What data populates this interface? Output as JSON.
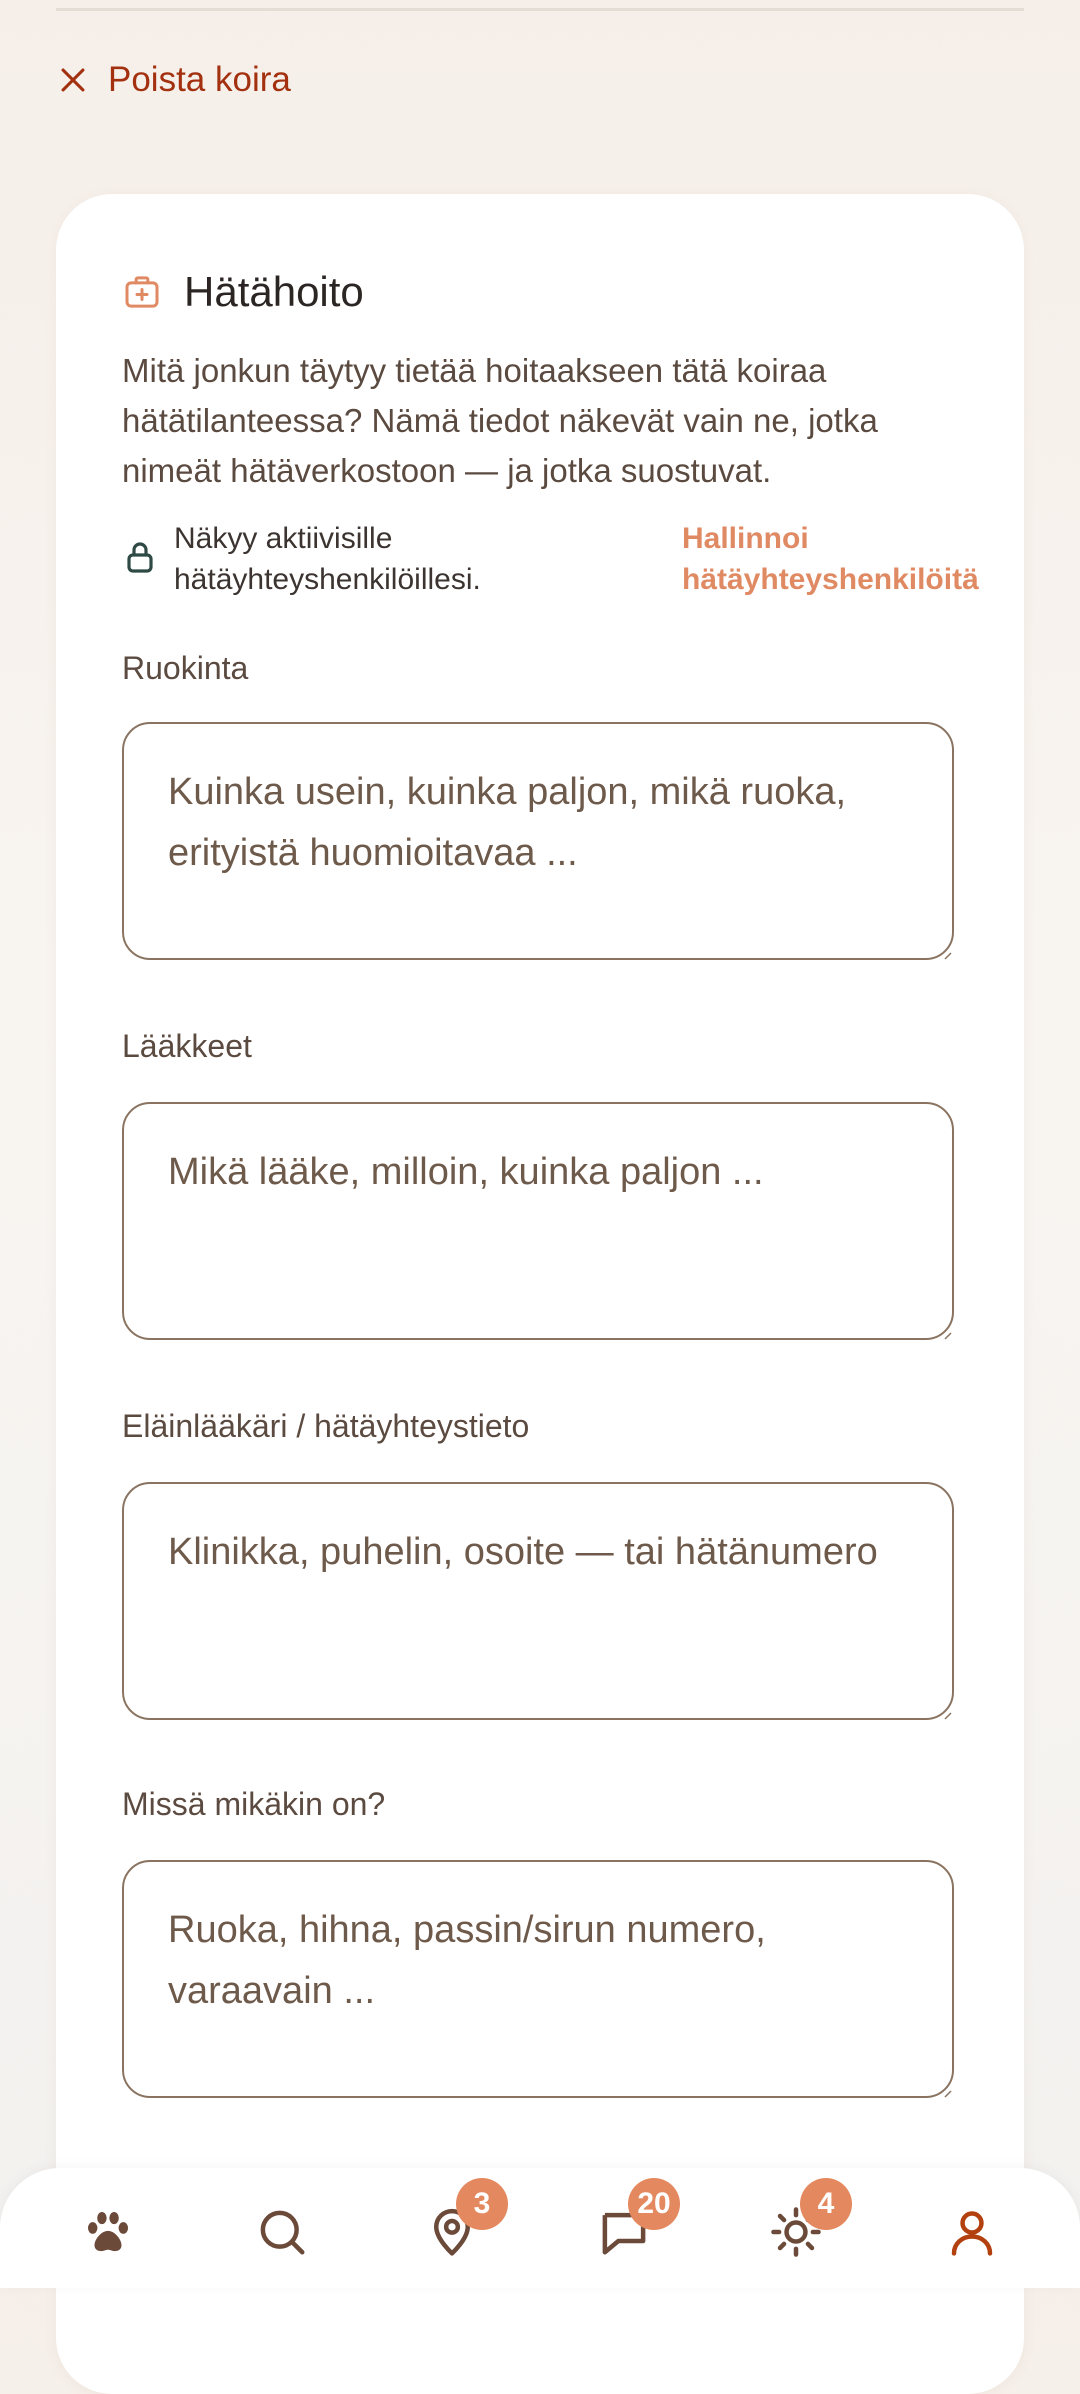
{
  "remove_dog": {
    "label": "Poista koira"
  },
  "emergency": {
    "title": "Hätähoito",
    "intro": "Mitä jonkun täytyy tietää hoitaakseen tätä koiraa hätätilanteessa? Nämä tiedot näkevät vain ne, jotka nimeät hätäverkostoon — ja jotka suostuvat.",
    "visibility_text": "Näkyy aktiivisille hätäyhteyshenkilöillesi.",
    "manage_link": "Hallinnoi hätäyhteyshenkilöitä",
    "fields": [
      {
        "label": "Ruokinta",
        "value": "",
        "placeholder": "Kuinka usein, kuinka paljon, mikä ruoka, erityistä huomioitavaa ..."
      },
      {
        "label": "Lääkkeet",
        "value": "",
        "placeholder": "Mikä lääke, milloin, kuinka paljon ..."
      },
      {
        "label": "Eläinlääkäri / hätäyhteystieto",
        "value": "",
        "placeholder": "Klinikka, puhelin, osoite — tai hätänumero"
      },
      {
        "label": "Missä mikäkin on?",
        "value": "",
        "placeholder": "Ruoka, hihna, passin/sirun numero, varaavain ..."
      }
    ]
  },
  "nav": {
    "items": [
      {
        "icon": "paw-icon",
        "badge": null
      },
      {
        "icon": "search-icon",
        "badge": null
      },
      {
        "icon": "map-pin-icon",
        "badge": "3"
      },
      {
        "icon": "chat-icon",
        "badge": "20"
      },
      {
        "icon": "sun-icon",
        "badge": "4"
      },
      {
        "icon": "profile-icon",
        "badge": null
      }
    ]
  },
  "colors": {
    "accent": "#e08a63",
    "danger": "#a3300f",
    "badge": "#e4895f",
    "field_border": "#8a7461",
    "icon_dark": "#6b4a3a"
  }
}
